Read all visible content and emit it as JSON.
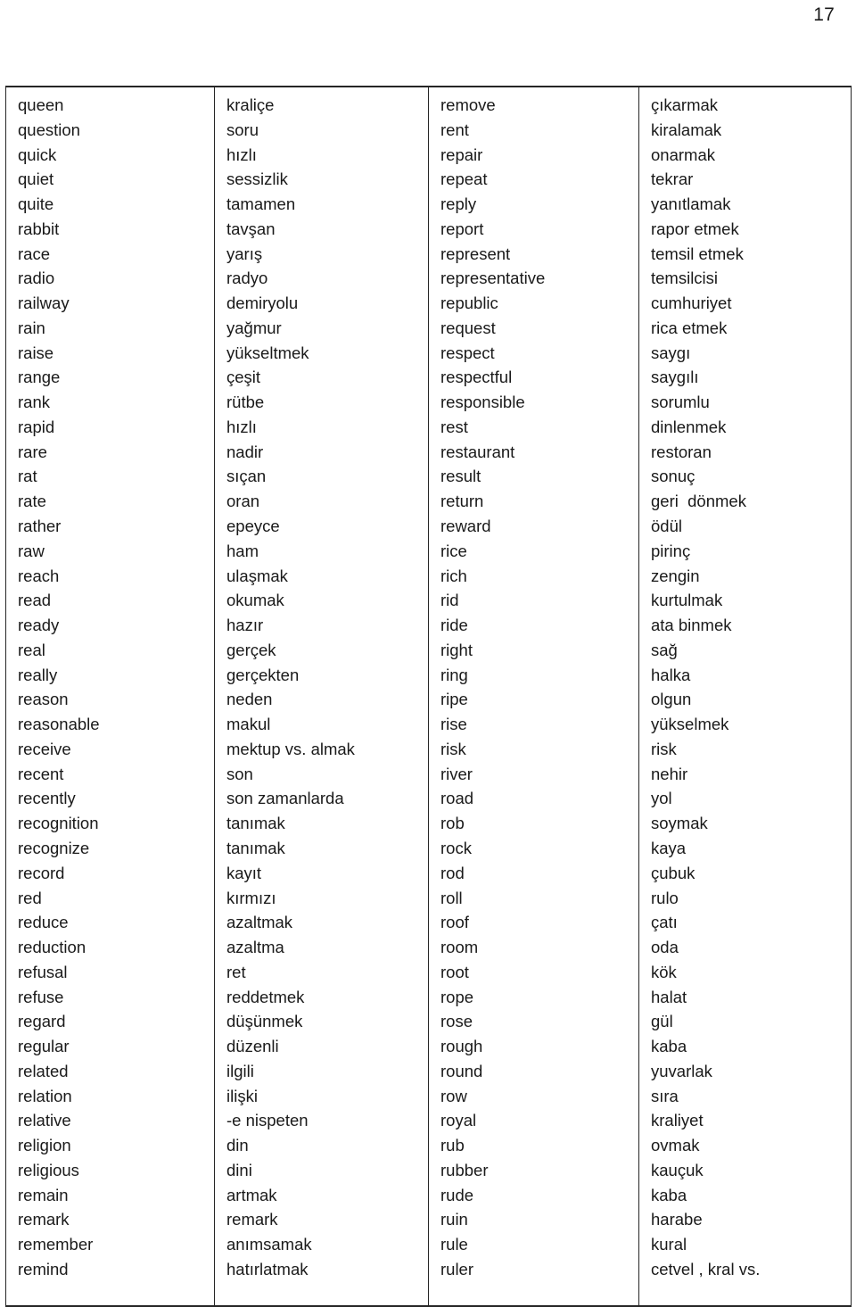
{
  "page": {
    "number": "17",
    "type": "vocabulary-list",
    "language_pair": "English-Turkish"
  },
  "table": {
    "column_count": 4,
    "columns": [
      {
        "name": "english-column-1",
        "entries": [
          "queen",
          "question",
          "quick",
          "quiet",
          "quite",
          "rabbit",
          "race",
          "radio",
          "railway",
          "rain",
          "raise",
          "range",
          "rank",
          "rapid",
          "rare",
          "rat",
          "rate",
          "rather",
          "raw",
          "reach",
          "read",
          "ready",
          "real",
          "really",
          "reason",
          "reasonable",
          "receive",
          "recent",
          "recently",
          "recognition",
          "recognize",
          "record",
          "red",
          "reduce",
          "reduction",
          "refusal",
          "refuse",
          "regard",
          "regular",
          "related",
          "relation",
          "relative",
          "religion",
          "religious",
          "remain",
          "remark",
          "remember",
          "remind"
        ]
      },
      {
        "name": "turkish-column-1",
        "entries": [
          "kraliçe",
          "soru",
          "hızlı",
          "sessizlik",
          "tamamen",
          "tavşan",
          "yarış",
          "radyo",
          "demiryolu",
          "yağmur",
          "yükseltmek",
          "çeşit",
          "rütbe",
          "hızlı",
          "nadir",
          "sıçan",
          "oran",
          "epeyce",
          "ham",
          "ulaşmak",
          "okumak",
          "hazır",
          "gerçek",
          "gerçekten",
          "neden",
          "makul",
          "mektup vs. almak",
          "son",
          "son zamanlarda",
          "tanımak",
          "tanımak",
          "kayıt",
          "kırmızı",
          "azaltmak",
          "azaltma",
          "ret",
          "reddetmek",
          "düşünmek",
          "düzenli",
          "ilgili",
          "ilişki",
          "-e nispeten",
          "din",
          "dini",
          "artmak",
          "remark",
          "anımsamak",
          "hatırlatmak"
        ]
      },
      {
        "name": "english-column-2",
        "entries": [
          "remove",
          "rent",
          "repair",
          "repeat",
          "reply",
          "report",
          "represent",
          "representative",
          "republic",
          "request",
          "respect",
          "respectful",
          "responsible",
          "rest",
          "restaurant",
          "result",
          "return",
          "reward",
          "rice",
          "rich",
          "rid",
          "ride",
          "right",
          "ring",
          "ripe",
          "rise",
          "risk",
          "river",
          "road",
          "rob",
          "rock",
          "rod",
          "roll",
          "roof",
          "room",
          "root",
          "rope",
          "rose",
          "rough",
          "round",
          "row",
          "royal",
          "rub",
          "rubber",
          "rude",
          "ruin",
          "rule",
          "ruler"
        ]
      },
      {
        "name": "turkish-column-2",
        "entries": [
          "çıkarmak",
          "kiralamak",
          "onarmak",
          "tekrar",
          "yanıtlamak",
          "rapor etmek",
          "temsil etmek",
          "temsilcisi",
          "cumhuriyet",
          "rica etmek",
          "saygı",
          "saygılı",
          "sorumlu",
          "dinlenmek",
          "restoran",
          "sonuç",
          "geri  dönmek",
          "ödül",
          "pirinç",
          "zengin",
          "kurtulmak",
          "ata binmek",
          "sağ",
          "halka",
          "olgun",
          "yükselmek",
          "risk",
          "nehir",
          "yol",
          "soymak",
          "kaya",
          "çubuk",
          "rulo",
          "çatı",
          "oda",
          "kök",
          "halat",
          "gül",
          "kaba",
          "yuvarlak",
          "sıra",
          "kraliyet",
          "ovmak",
          "kauçuk",
          "kaba",
          "harabe",
          "kural",
          "cetvel , kral vs."
        ]
      }
    ]
  },
  "colors": {
    "text": "#1a1a1a",
    "border": "#262626",
    "background": "#ffffff"
  }
}
